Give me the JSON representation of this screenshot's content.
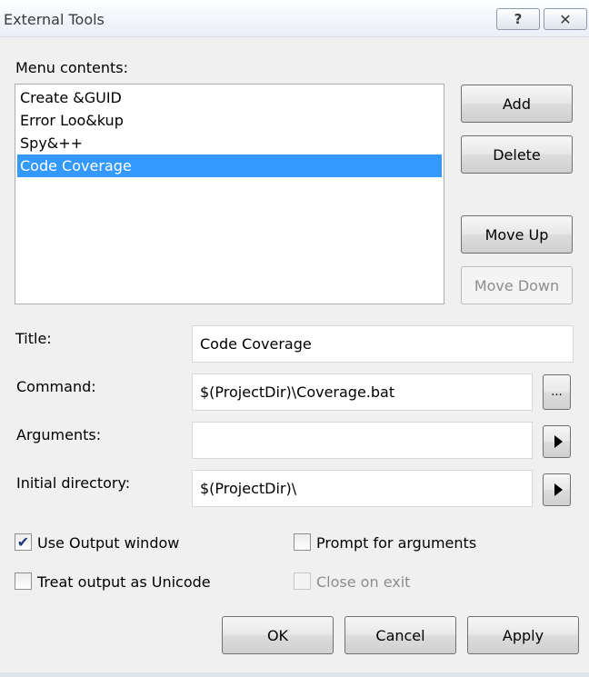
{
  "window": {
    "title": "External Tools",
    "help_label": "?",
    "close_glyph": "✕"
  },
  "menu": {
    "label": "Menu contents:",
    "items": [
      {
        "label": "Create &GUID",
        "selected": false
      },
      {
        "label": "Error Loo&kup",
        "selected": false
      },
      {
        "label": "Spy&++",
        "selected": false
      },
      {
        "label": "Code Coverage",
        "selected": true
      }
    ]
  },
  "side_buttons": {
    "add": "Add",
    "delete": "Delete",
    "move_up": "Move Up",
    "move_down": "Move Down"
  },
  "fields": {
    "title": {
      "label": "Title:",
      "value": "Code Coverage"
    },
    "command": {
      "label": "Command:",
      "value": "$(ProjectDir)\\Coverage.bat",
      "browse_label": "..."
    },
    "arguments": {
      "label": "Arguments:",
      "value": ""
    },
    "initial_directory": {
      "label": "Initial directory:",
      "value": "$(ProjectDir)\\"
    }
  },
  "options": {
    "use_output_window": {
      "label": "Use Output window",
      "checked": true,
      "enabled": true
    },
    "prompt_for_arguments": {
      "label": "Prompt for arguments",
      "checked": false,
      "enabled": true
    },
    "treat_output_unicode": {
      "label": "Treat output as Unicode",
      "checked": false,
      "enabled": true
    },
    "close_on_exit": {
      "label": "Close on exit",
      "checked": false,
      "enabled": false
    }
  },
  "dialog_buttons": {
    "ok": "OK",
    "cancel": "Cancel",
    "apply": "Apply"
  },
  "icons": {
    "check": "✔",
    "expand_arrow": "right-triangle"
  }
}
